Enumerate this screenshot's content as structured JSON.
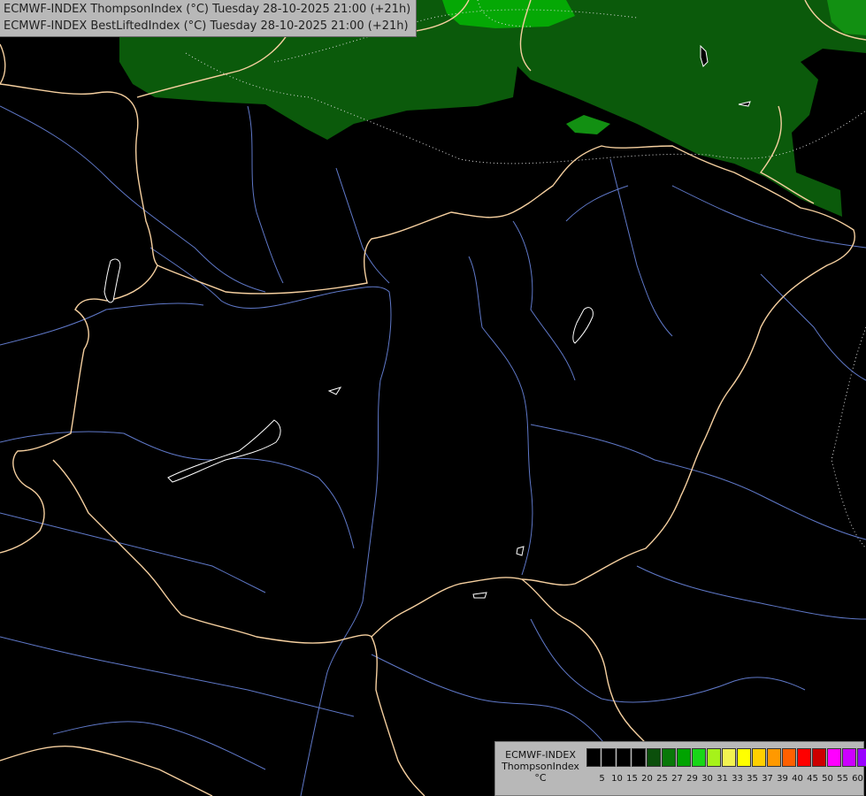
{
  "title": {
    "line1": "ECMWF-INDEX ThompsonIndex (°C) Tuesday 28-10-2025 21:00 (+21h)",
    "line2": "ECMWF-INDEX BestLiftedIndex (°C) Tuesday 28-10-2025 21:00 (+21h)"
  },
  "legend": {
    "model": "ECMWF-INDEX",
    "variable": "ThompsonIndex",
    "unit": "°C",
    "colors": [
      "#000000",
      "#000000",
      "#000000",
      "#000000",
      "#0b4f0b",
      "#097809",
      "#00a300",
      "#18d618",
      "#a6f21a",
      "#f2f251",
      "#ffff00",
      "#ffd000",
      "#ff9900",
      "#ff6000",
      "#ff0000",
      "#cc0000",
      "#ff00ff",
      "#cc00ff",
      "#9900ff",
      "#6600ff",
      "#0000ff"
    ],
    "ticks": [
      "5",
      "10",
      "15",
      "20",
      "25",
      "27",
      "29",
      "30",
      "31",
      "33",
      "35",
      "37",
      "39",
      "40",
      "45",
      "50",
      "55",
      "60"
    ]
  },
  "map_colors": {
    "background": "#000000",
    "dark_green": "#0b5a0b",
    "mid_green": "#138b13",
    "bright_green": "#00b300",
    "borders": "#f5cf9f",
    "rivers": "#5f78c8",
    "lakes": "#ffffff",
    "contours": "#dddddd"
  }
}
